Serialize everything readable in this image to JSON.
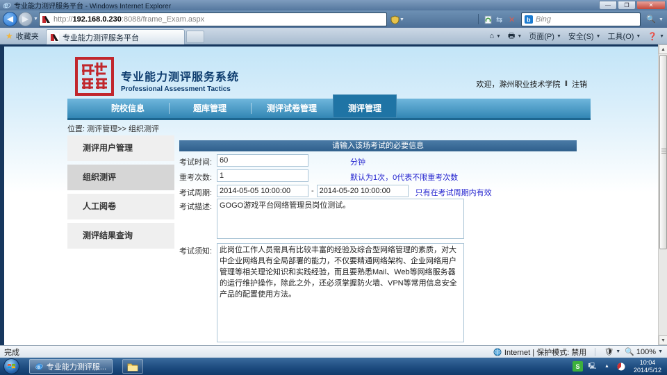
{
  "colors": {
    "navy": "#17375e",
    "nav_blue": "#3286b4",
    "nav_active": "#1f74a5",
    "seal_red": "#c1272d",
    "hint_blue": "#2323cf",
    "header_bar": "#2f5f8c"
  },
  "window": {
    "title": "专业能力测评服务平台 - Windows Internet Explorer"
  },
  "browser": {
    "url": {
      "prefix": "http://",
      "host": "192.168.0.230",
      "rest": ":8088/frame_Exam.aspx"
    },
    "search": {
      "provider": "Bing"
    },
    "favorites_label": "收藏夹",
    "tab_title": "专业能力测评服务平台",
    "command_bar": {
      "page": "页面(P)",
      "safety": "安全(S)",
      "tools": "工具(O)"
    }
  },
  "page": {
    "logo": {
      "title": "专业能力测评服务系统",
      "subtitle": "Professional Assessment Tactics"
    },
    "welcome": {
      "greeting": "欢迎，滁州职业技术学院",
      "separator": "‖",
      "logout": "注销"
    },
    "nav": [
      {
        "label": "院校信息"
      },
      {
        "label": "题库管理"
      },
      {
        "label": "测评试卷管理"
      },
      {
        "label": "测评管理"
      }
    ],
    "breadcrumb": "位置: 测评管理>> 组织测评",
    "sidebar": [
      {
        "label": "测评用户管理"
      },
      {
        "label": "组织测评"
      },
      {
        "label": "人工阅卷"
      },
      {
        "label": "测评结果查询"
      }
    ],
    "form": {
      "header": "请输入该场考试的必要信息",
      "duration": {
        "label": "考试时间:",
        "value": "60",
        "hint": "分钟"
      },
      "retake": {
        "label": "重考次数:",
        "value": "1",
        "hint": "默认为1次，0代表不限重考次数"
      },
      "period": {
        "label": "考试周期:",
        "start": "2014-05-05 10:00:00",
        "sep": "-",
        "end": "2014-05-20 10:00:00",
        "hint": "只有在考试周期内有效"
      },
      "description": {
        "label": "考试描述:",
        "value": "GOGO游戏平台网络管理员岗位测试。"
      },
      "notice": {
        "label": "考试须知:",
        "value": "此岗位工作人员需具有比较丰富的经验及综合型网络管理的素质，对大中企业网络具有全局部署的能力，不仅要精通网络架构、企业网络用户管理等相关理论知识和实践经验，而且要熟悉Mail、Web等网络服务器的运行维护操作，除此之外，还必须掌握防火墙、VPN等常用信息安全产品的配置使用方法。"
      }
    }
  },
  "status_bar": {
    "left": "完成",
    "zone": "Internet | 保护模式: 禁用",
    "zoom": "100%"
  },
  "taskbar": {
    "ie_button": "专业能力测评服...",
    "time": "10:04",
    "date": "2014/5/12"
  }
}
